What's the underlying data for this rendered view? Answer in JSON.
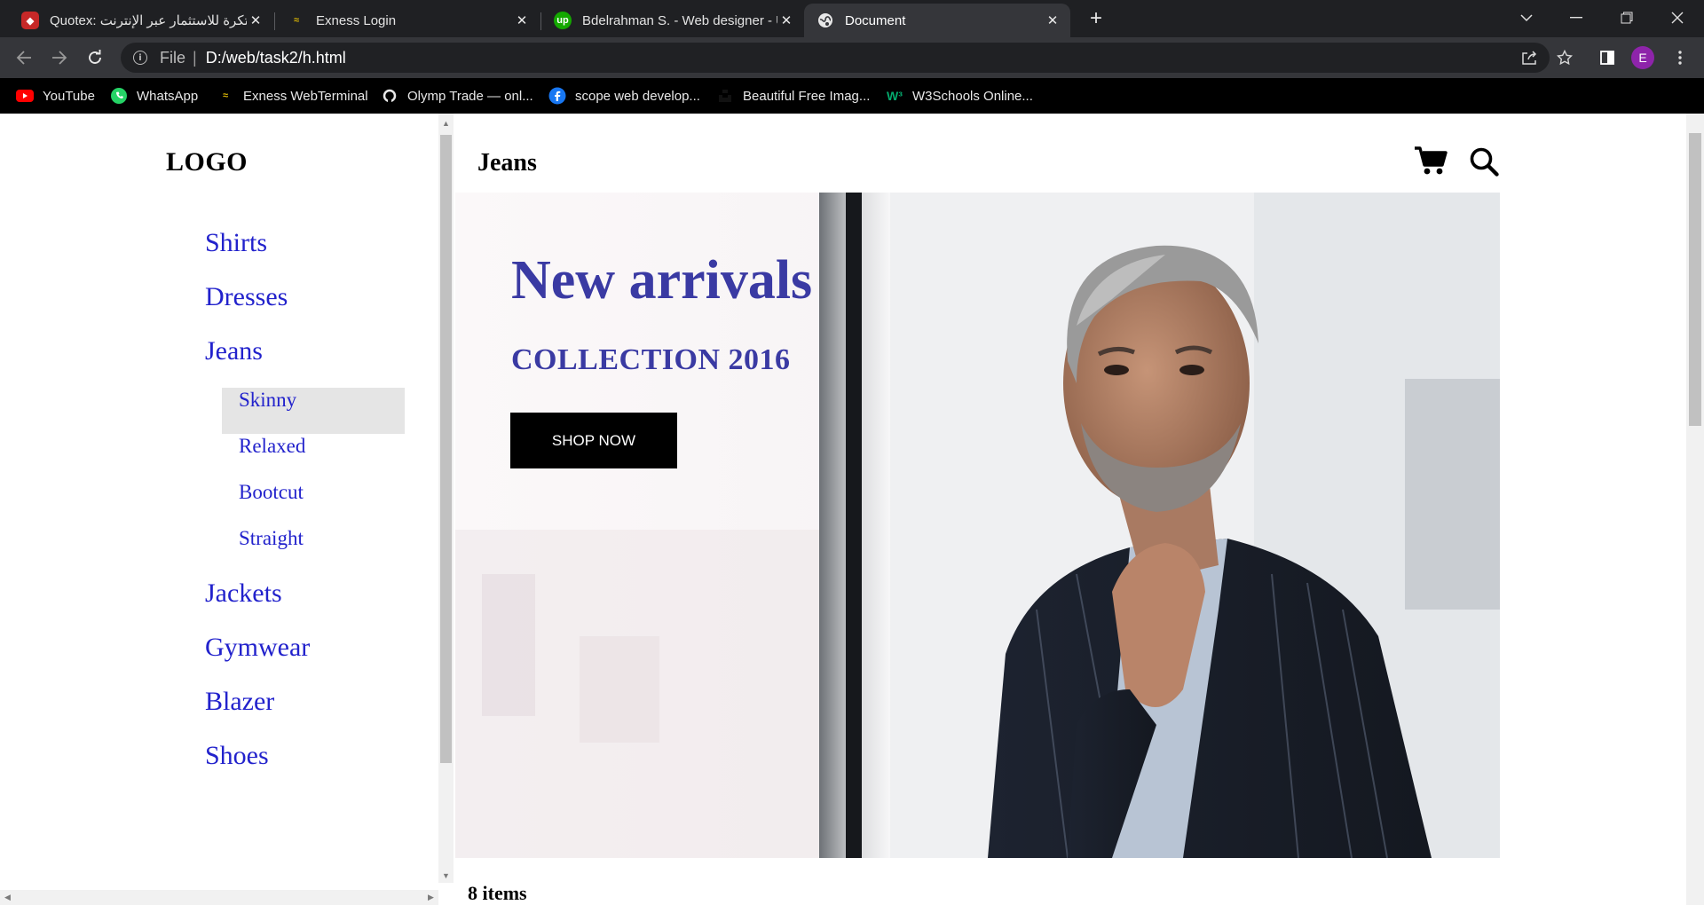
{
  "browser": {
    "tabs": [
      {
        "title": "Quotex: منصة مبتكرة للاستثمار عبر الإنترنت",
        "favicon": "quotex-icon",
        "color": "#c62828"
      },
      {
        "title": "Exness Login",
        "favicon": "exness-icon",
        "color": "#d4b106"
      },
      {
        "title": "Bdelrahman S. - Web designer - Upwork",
        "favicon": "upwork-icon",
        "color": "#14a800"
      },
      {
        "title": "Document",
        "favicon": "globe-icon",
        "active": true
      }
    ],
    "address": {
      "scheme": "File",
      "url": "D:/web/task2/h.html"
    },
    "profile_initial": "E",
    "bookmarks": [
      {
        "label": "YouTube",
        "icon": "youtube-icon"
      },
      {
        "label": "WhatsApp",
        "icon": "whatsapp-icon"
      },
      {
        "label": "Exness WebTerminal",
        "icon": "exness-icon"
      },
      {
        "label": "Olymp Trade — onl...",
        "icon": "olymp-icon"
      },
      {
        "label": "scope web develop...",
        "icon": "facebook-icon"
      },
      {
        "label": "Beautiful Free Imag...",
        "icon": "unsplash-icon"
      },
      {
        "label": "W3Schools Online...",
        "icon": "w3schools-icon"
      }
    ]
  },
  "sidebar": {
    "logo": "LOGO",
    "items": [
      "Shirts",
      "Dresses",
      "Jeans",
      "Jackets",
      "Gymwear",
      "Blazer",
      "Shoes"
    ],
    "jeans_subitems": [
      "Skinny",
      "Relaxed",
      "Bootcut",
      "Straight"
    ],
    "selected_subitem": "Skinny"
  },
  "main": {
    "heading": "Jeans",
    "icons": [
      "shopping-cart-icon",
      "search-icon"
    ],
    "hero": {
      "title": "New arrivals",
      "subtitle": "COLLECTION 2016",
      "button": "SHOP NOW"
    },
    "items_count": "8 items"
  },
  "colors": {
    "hero_text": "#3a3aa3",
    "nav_link": "#2222cc",
    "button_bg": "#000000",
    "selected_bg": "#e5e5e5"
  }
}
